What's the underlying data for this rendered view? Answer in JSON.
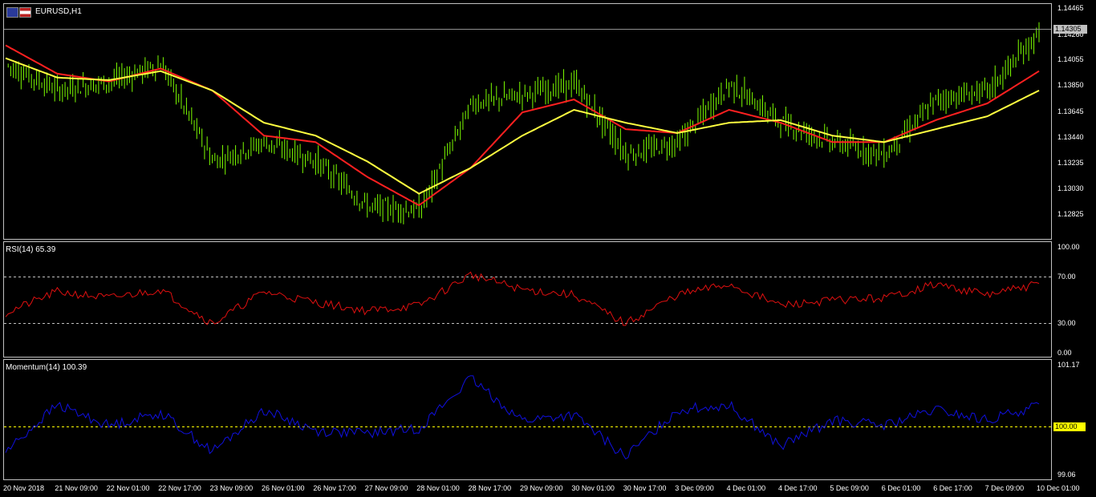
{
  "window": {
    "symbol_title": "EURUSD,H1"
  },
  "price_panel": {
    "current_price": "1.14305",
    "axis_ticks": [
      "1.14465",
      "1.14260",
      "1.14055",
      "1.13850",
      "1.13645",
      "1.13440",
      "1.13235",
      "1.13030",
      "1.12825"
    ]
  },
  "rsi_panel": {
    "label": "RSI(14) 65.39",
    "axis_ticks": [
      "100.00",
      "70.00",
      "30.00",
      "0.00"
    ]
  },
  "momentum_panel": {
    "label": "Momentum(14) 100.39",
    "axis_ticks": [
      "101.17",
      "99.06"
    ],
    "level_tag": "100.00"
  },
  "time_axis": {
    "labels": [
      "20 Nov 2018",
      "21 Nov 09:00",
      "22 Nov 01:00",
      "22 Nov 17:00",
      "23 Nov 09:00",
      "26 Nov 01:00",
      "26 Nov 17:00",
      "27 Nov 09:00",
      "28 Nov 01:00",
      "28 Nov 17:00",
      "29 Nov 09:00",
      "30 Nov 01:00",
      "30 Nov 17:00",
      "3 Dec 09:00",
      "4 Dec 01:00",
      "4 Dec 17:00",
      "5 Dec 09:00",
      "6 Dec 01:00",
      "6 Dec 17:00",
      "7 Dec 09:00",
      "10 Dec 01:00"
    ]
  },
  "colors": {
    "candles": "#7cfc00",
    "ma_fast": "#ff2020",
    "ma_slow": "#ffff40",
    "rsi_line": "#e01010",
    "momentum_line": "#1010e0",
    "grid_border": "#c0c0c0"
  },
  "chart_data": [
    {
      "type": "line",
      "title": "EURUSD,H1",
      "x": [
        "20 Nov 2018",
        "21 Nov 09:00",
        "22 Nov 01:00",
        "22 Nov 17:00",
        "23 Nov 09:00",
        "26 Nov 01:00",
        "26 Nov 17:00",
        "27 Nov 09:00",
        "28 Nov 01:00",
        "28 Nov 17:00",
        "29 Nov 09:00",
        "30 Nov 01:00",
        "30 Nov 17:00",
        "3 Dec 09:00",
        "4 Dec 01:00",
        "4 Dec 17:00",
        "5 Dec 09:00",
        "6 Dec 01:00",
        "6 Dec 17:00",
        "7 Dec 09:00",
        "10 Dec 01:00"
      ],
      "series": [
        {
          "values": [
            1.1405,
            1.1385,
            1.1392,
            1.1405,
            1.133,
            1.1345,
            1.133,
            1.1295,
            1.1292,
            1.1375,
            1.1382,
            1.139,
            1.1335,
            1.1345,
            1.139,
            1.136,
            1.1345,
            1.1335,
            1.1378,
            1.1385,
            1.143
          ]
        },
        {
          "values": [
            1.142,
            1.1398,
            1.1392,
            1.1402,
            1.1385,
            1.135,
            1.1345,
            1.1318,
            1.1296,
            1.1325,
            1.1368,
            1.1378,
            1.1355,
            1.1352,
            1.137,
            1.136,
            1.1345,
            1.1345,
            1.1362,
            1.1375,
            1.14
          ]
        },
        {
          "values": [
            1.141,
            1.1395,
            1.1393,
            1.14,
            1.1385,
            1.136,
            1.135,
            1.133,
            1.1305,
            1.1325,
            1.135,
            1.137,
            1.136,
            1.1352,
            1.136,
            1.1362,
            1.135,
            1.1345,
            1.1355,
            1.1365,
            1.1385
          ]
        }
      ],
      "ylim": [
        1.127,
        1.1452
      ]
    },
    {
      "type": "line",
      "title": "RSI(14) 65.39",
      "x": [
        "20 Nov 2018",
        "21 Nov 09:00",
        "22 Nov 01:00",
        "22 Nov 17:00",
        "23 Nov 09:00",
        "26 Nov 01:00",
        "26 Nov 17:00",
        "27 Nov 09:00",
        "28 Nov 01:00",
        "28 Nov 17:00",
        "29 Nov 09:00",
        "30 Nov 01:00",
        "30 Nov 17:00",
        "3 Dec 09:00",
        "4 Dec 01:00",
        "4 Dec 17:00",
        "5 Dec 09:00",
        "6 Dec 01:00",
        "6 Dec 17:00",
        "7 Dec 09:00",
        "10 Dec 01:00"
      ],
      "values": [
        38,
        58,
        52,
        60,
        28,
        58,
        48,
        40,
        45,
        74,
        60,
        55,
        28,
        55,
        65,
        45,
        50,
        52,
        65,
        55,
        65
      ],
      "ylim": [
        0,
        100
      ]
    },
    {
      "type": "line",
      "title": "Momentum(14) 100.39",
      "x": [
        "20 Nov 2018",
        "21 Nov 09:00",
        "22 Nov 01:00",
        "22 Nov 17:00",
        "23 Nov 09:00",
        "26 Nov 01:00",
        "26 Nov 17:00",
        "27 Nov 09:00",
        "28 Nov 01:00",
        "28 Nov 17:00",
        "29 Nov 09:00",
        "30 Nov 01:00",
        "30 Nov 17:00",
        "3 Dec 09:00",
        "4 Dec 01:00",
        "4 Dec 17:00",
        "5 Dec 09:00",
        "6 Dec 01:00",
        "6 Dec 17:00",
        "7 Dec 09:00",
        "10 Dec 01:00"
      ],
      "values": [
        99.5,
        100.4,
        100.0,
        100.25,
        99.5,
        100.3,
        99.9,
        99.85,
        99.95,
        100.9,
        100.1,
        100.2,
        99.4,
        100.3,
        100.4,
        99.6,
        100.1,
        100.0,
        100.3,
        100.1,
        100.39
      ],
      "ylim": [
        99.06,
        101.17
      ]
    }
  ]
}
